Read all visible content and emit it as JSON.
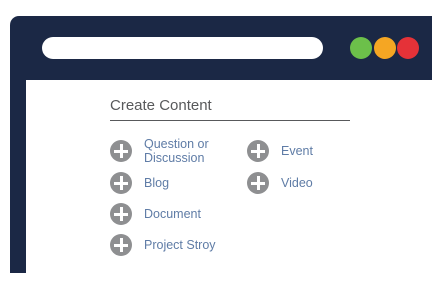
{
  "window": {
    "controls": [
      {
        "name": "green-window-button",
        "color": "#6cc04a"
      },
      {
        "name": "yellow-window-button",
        "color": "#f5a623"
      },
      {
        "name": "red-window-button",
        "color": "#e53238"
      }
    ]
  },
  "panel": {
    "title": "Create Content",
    "left_items": [
      {
        "label": "Question or Discussion",
        "icon": "plus-circle-icon"
      },
      {
        "label": "Blog",
        "icon": "plus-circle-icon"
      },
      {
        "label": "Document",
        "icon": "plus-circle-icon"
      },
      {
        "label": "Project Stroy",
        "icon": "plus-circle-icon"
      }
    ],
    "right_items": [
      {
        "label": "Event",
        "icon": "plus-circle-icon"
      },
      {
        "label": "Video",
        "icon": "plus-circle-icon"
      }
    ]
  },
  "colors": {
    "frame": "#1b2845",
    "icon": "#8e8f91",
    "link": "#5f7ca6",
    "heading": "#58595b"
  }
}
